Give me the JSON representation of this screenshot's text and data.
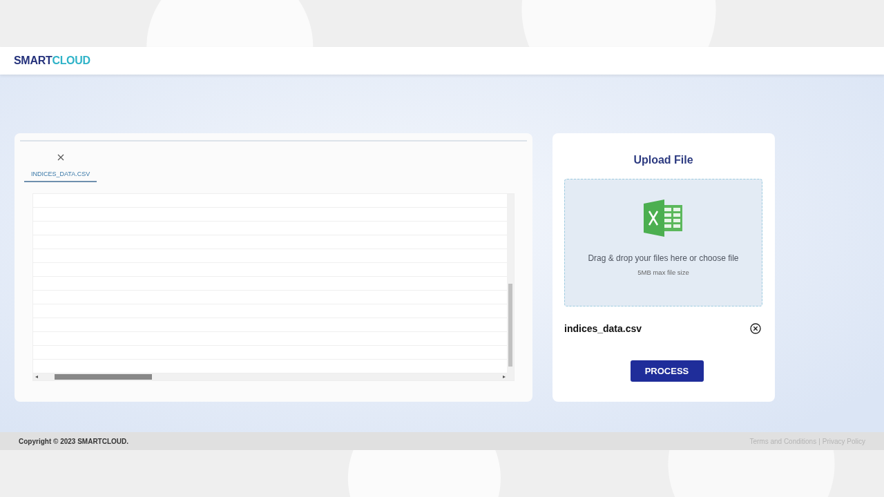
{
  "header": {
    "logo": {
      "part_1": "SMART",
      "part_2": "CLOUD"
    }
  },
  "preview": {
    "tabs": [
      {
        "label": "INDICES_DATA.CSV",
        "selected": true
      }
    ]
  },
  "upload": {
    "title": "Upload File",
    "dropzone": {
      "text": "Drag & drop your files here or choose file",
      "hint": "5MB max file size"
    },
    "files": [
      {
        "name": "indices_data.csv"
      }
    ],
    "button": "PROCESS"
  },
  "footer": {
    "copyright": "Copyright © 2023 SMARTCLOUD.",
    "links": [
      "Terms and Conditions",
      "Privacy Policy"
    ],
    "separator": "|"
  }
}
